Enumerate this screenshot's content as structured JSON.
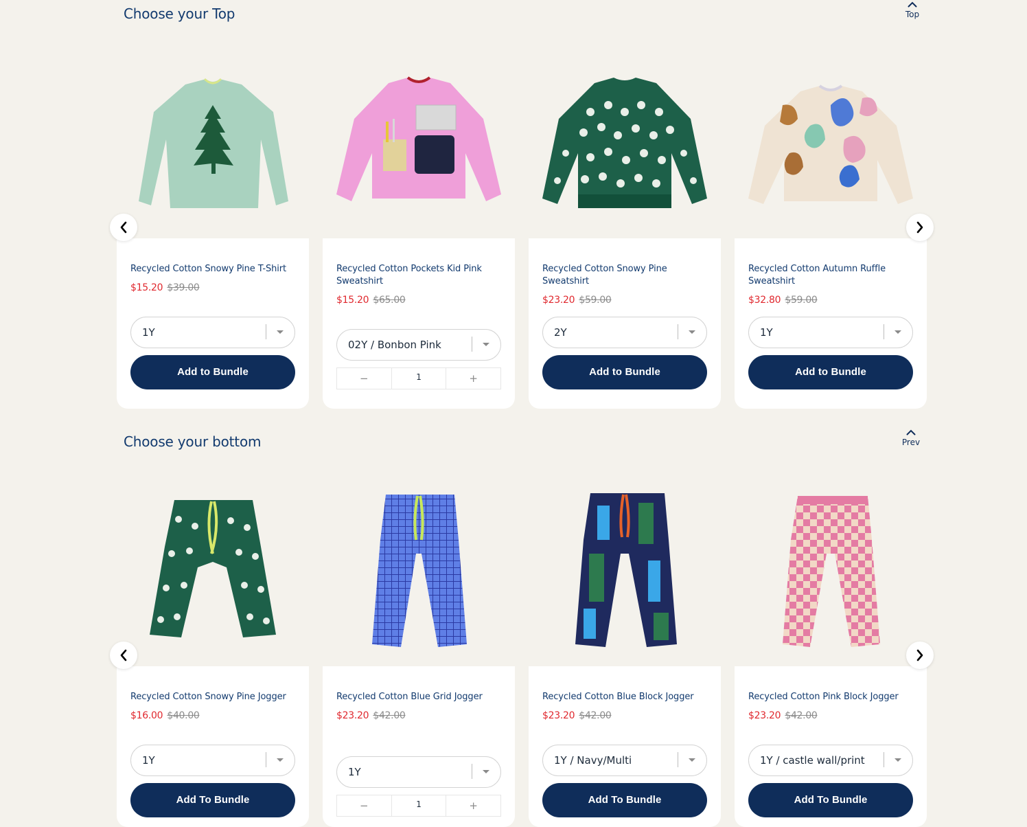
{
  "tops": {
    "title": "Choose your Top",
    "nav_label": "Top",
    "products": [
      {
        "name": "Recycled Cotton Snowy Pine T-Shirt",
        "price": "$15.20",
        "was": "$39.00",
        "option": "1Y",
        "button": "Add to Bundle"
      },
      {
        "name": "Recycled Cotton Pockets Kid Pink Sweatshirt",
        "price": "$15.20",
        "was": "$65.00",
        "option": "02Y / Bonbon Pink",
        "qty": "1",
        "minus": "−",
        "plus": "+"
      },
      {
        "name": "Recycled Cotton Snowy Pine Sweatshirt",
        "price": "$23.20",
        "was": "$59.00",
        "option": "2Y",
        "button": "Add to Bundle"
      },
      {
        "name": "Recycled Cotton Autumn Ruffle Sweatshirt",
        "price": "$32.80",
        "was": "$59.00",
        "option": "1Y",
        "button": "Add to Bundle"
      }
    ]
  },
  "bottoms": {
    "title": "Choose your bottom",
    "nav_label": "Prev",
    "products": [
      {
        "name": "Recycled Cotton Snowy Pine Jogger",
        "price": "$16.00",
        "was": "$40.00",
        "option": "1Y",
        "button": "Add To Bundle"
      },
      {
        "name": "Recycled Cotton Blue Grid Jogger",
        "price": "$23.20",
        "was": "$42.00",
        "option": "1Y",
        "qty": "1",
        "minus": "−",
        "plus": "+"
      },
      {
        "name": "Recycled Cotton Blue Block Jogger",
        "price": "$23.20",
        "was": "$42.00",
        "option": "1Y / Navy/Multi",
        "button": "Add To Bundle"
      },
      {
        "name": "Recycled Cotton Pink Block Jogger",
        "price": "$23.20",
        "was": "$42.00",
        "option": "1Y / castle wall/print",
        "button": "Add To Bundle"
      }
    ]
  },
  "colors": {
    "navy": "#0f2d5a",
    "sale": "#e0282e",
    "background": "#f4f2ec"
  },
  "icons": [
    "chevron-up-icon",
    "chevron-left-icon",
    "chevron-right-icon",
    "caret-down-icon"
  ]
}
